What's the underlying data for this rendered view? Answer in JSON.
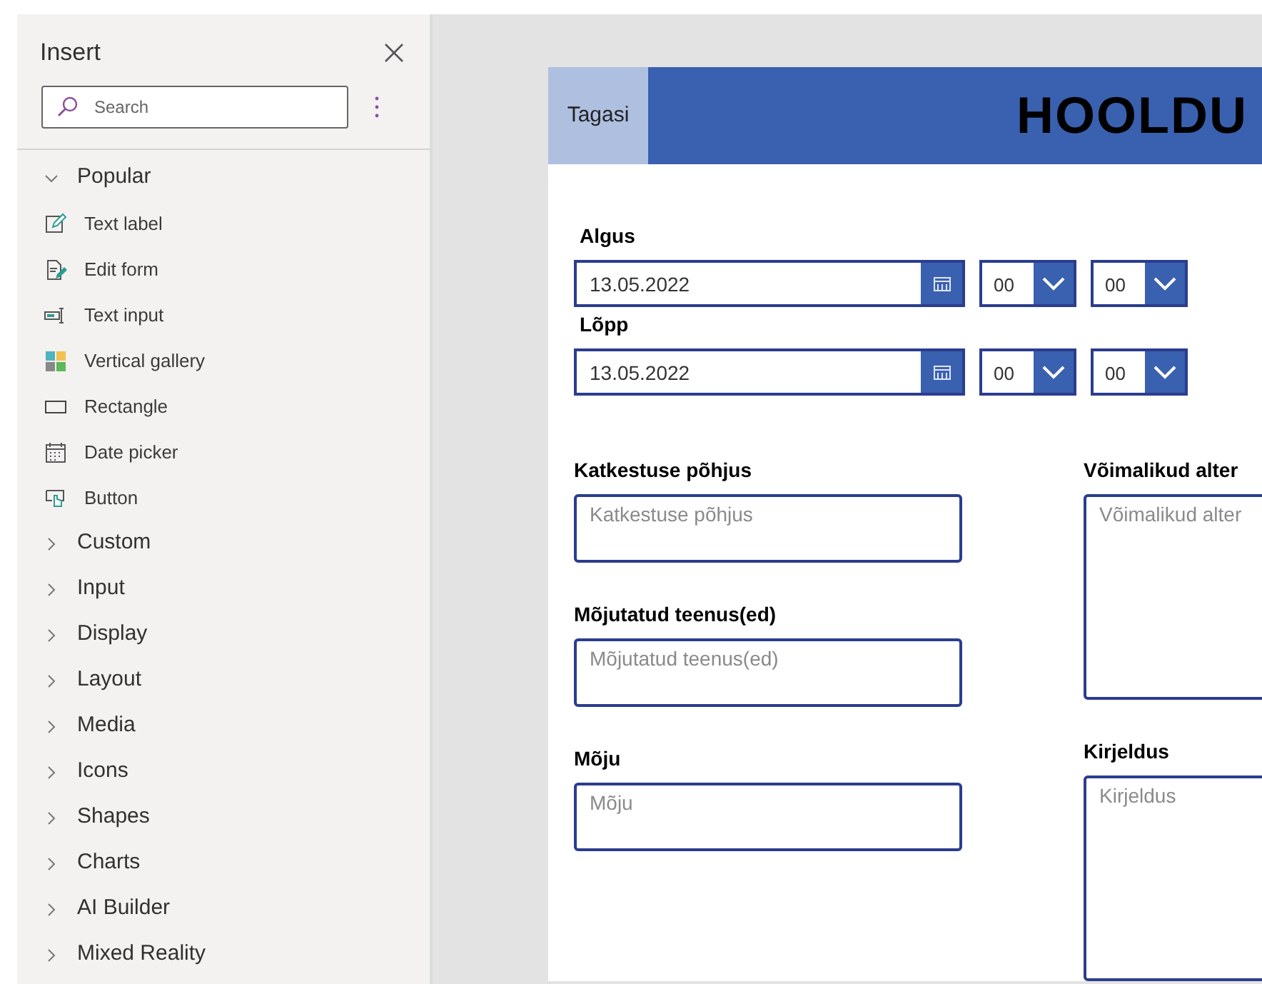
{
  "insert_panel": {
    "title": "Insert",
    "search": {
      "placeholder": "Search"
    },
    "sections": [
      {
        "label": "Popular",
        "expanded": true,
        "items": [
          {
            "label": "Text label",
            "kind": "label"
          },
          {
            "label": "Edit form",
            "kind": "form"
          },
          {
            "label": "Text input",
            "kind": "input"
          },
          {
            "label": "Vertical gallery",
            "kind": "gallery"
          },
          {
            "label": "Rectangle",
            "kind": "rectangle"
          },
          {
            "label": "Date picker",
            "kind": "date"
          },
          {
            "label": "Button",
            "kind": "button"
          }
        ]
      },
      {
        "label": "Custom",
        "expanded": false
      },
      {
        "label": "Input",
        "expanded": false
      },
      {
        "label": "Display",
        "expanded": false
      },
      {
        "label": "Layout",
        "expanded": false
      },
      {
        "label": "Media",
        "expanded": false
      },
      {
        "label": "Icons",
        "expanded": false
      },
      {
        "label": "Shapes",
        "expanded": false
      },
      {
        "label": "Charts",
        "expanded": false
      },
      {
        "label": "AI Builder",
        "expanded": false
      },
      {
        "label": "Mixed Reality",
        "expanded": false
      }
    ]
  },
  "app": {
    "back_button": "Tagasi",
    "title": "HOOLDU",
    "date_rows": [
      {
        "label": "Algus",
        "date": "13.05.2022",
        "hour": "00",
        "minute": "00"
      },
      {
        "label": "Lõpp",
        "date": "13.05.2022",
        "hour": "00",
        "minute": "00"
      }
    ],
    "left_fields": [
      {
        "label": "Katkestuse põhjus",
        "placeholder": "Katkestuse põhjus",
        "tall": false
      },
      {
        "label": "Mõjutatud teenus(ed)",
        "placeholder": "Mõjutatud teenus(ed)",
        "tall": false
      },
      {
        "label": "Mõju",
        "placeholder": "Mõju",
        "tall": false
      }
    ],
    "right_fields": [
      {
        "label": "Võimalikud alter",
        "placeholder": "Võimalikud alter",
        "tall": true
      },
      {
        "label": "Kirjeldus",
        "placeholder": "Kirjeldus",
        "tall": true
      }
    ]
  }
}
